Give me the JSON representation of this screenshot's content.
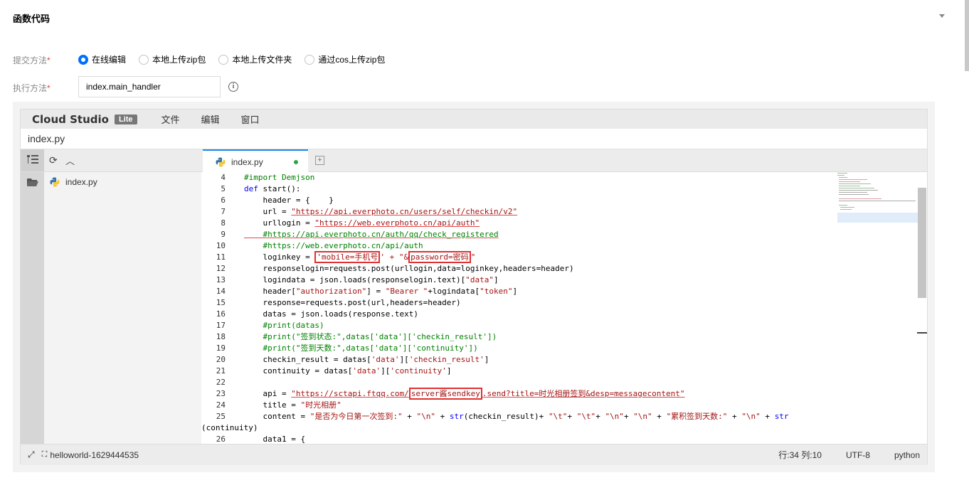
{
  "section": {
    "title": "函数代码"
  },
  "form": {
    "submit_label": "提交方法",
    "required_mark": "*",
    "submit_options": [
      "在线编辑",
      "本地上传zip包",
      "本地上传文件夹",
      "通过cos上传zip包"
    ],
    "submit_selected": "在线编辑",
    "exec_label": "执行方法",
    "exec_value": "index.main_handler"
  },
  "ide": {
    "brand": "Cloud Studio",
    "badge": "Lite",
    "menu": [
      "文件",
      "编辑",
      "窗口"
    ],
    "path": "index.py",
    "explorer": {
      "file": "index.py"
    },
    "tab": {
      "label": "index.py"
    },
    "status": {
      "project": "helloworld-1629444535",
      "position": "行:34 列:10",
      "encoding": "UTF-8",
      "language": "python"
    },
    "colors": {
      "accent": "#1e88e5",
      "highlight": "#e03030",
      "comment": "#008000",
      "keyword": "#0000ff",
      "string": "#a31515"
    }
  },
  "code": {
    "line_numbers": [
      "4",
      "5",
      "6",
      "7",
      "8",
      "9",
      "10",
      "11",
      "12",
      "13",
      "14",
      "15",
      "16",
      "17",
      "18",
      "19",
      "20",
      "21",
      "22",
      "23",
      "24",
      "25",
      "",
      "26"
    ],
    "l4": "#import Demjson",
    "l5_kw": "def",
    "l5_rest": " start():",
    "l6": "    header = {    }",
    "l7_a": "    url = ",
    "l7_s": "\"https://api.everphoto.cn/users/self/checkin/v2\"",
    "l8_a": "    urllogin = ",
    "l8_s": "\"https://web.everphoto.cn/api/auth\"",
    "l9": "    #https://api.everphoto.cn/auth/qq/check_registered",
    "l10": "    #https://web.everphoto.cn/api/auth",
    "l11_a": "    loginkey = ",
    "l11_s1": "'mobile=手机号",
    "l11_s2": "' + \"&",
    "l11_s3": "password=密码",
    "l11_s4": "\"",
    "l12": "    responselogin=requests.post(urllogin,data=loginkey,headers=header)",
    "l13_a": "    logindata = json.loads(responselogin.text)[",
    "l13_s": "\"data\"",
    "l13_b": "]",
    "l14_a": "    header[",
    "l14_s1": "\"authorization\"",
    "l14_b": "] = ",
    "l14_s2": "\"Bearer \"",
    "l14_c": "+logindata[",
    "l14_s3": "\"token\"",
    "l14_d": "]",
    "l15": "    response=requests.post(url,headers=header)",
    "l16": "    datas = json.loads(response.text)",
    "l17": "    #print(datas)",
    "l18": "    #print(\"签到状态:\",datas['data']['checkin_result'])",
    "l19": "    #print(\"签到天数:\",datas['data']['continuity'])",
    "l20_a": "    checkin_result = datas[",
    "l20_s1": "'data'",
    "l20_b": "][",
    "l20_s2": "'checkin_result'",
    "l20_c": "]",
    "l21_a": "    continuity = datas[",
    "l21_s1": "'data'",
    "l21_b": "][",
    "l21_s2": "'continuity'",
    "l21_c": "]",
    "l23_a": "    api = ",
    "l23_s1": "\"https://sctapi.ftqq.com/",
    "l23_s2": "server酱sendkey",
    "l23_s3": ".send?title=时光相册签到&desp=messagecontent\"",
    "l24_a": "    title = ",
    "l24_s": "\"时光相册\"",
    "l25_a": "    content = ",
    "l25_s1": "\"是否为今日第一次签到:\"",
    "l25_b": " + ",
    "l25_s2": "\"\\n\"",
    "l25_c": " + ",
    "l25_fn": "str",
    "l25_d": "(checkin_result)+ ",
    "l25_s3": "\"\\t\"",
    "l25_e": "+ ",
    "l25_s4": "\"\\t\"",
    "l25_f": "+ ",
    "l25_s5": "\"\\n\"",
    "l25_g": "+ ",
    "l25_s6": "\"\\n\"",
    "l25_h": " + ",
    "l25_s7": "\"累积签到天数:\"",
    "l25_i": " + ",
    "l25_s8": "\"\\n\"",
    "l25_j": " + ",
    "l25_fn2": "str",
    "l25_cont": "(continuity)",
    "l26": "    data1 = {"
  }
}
